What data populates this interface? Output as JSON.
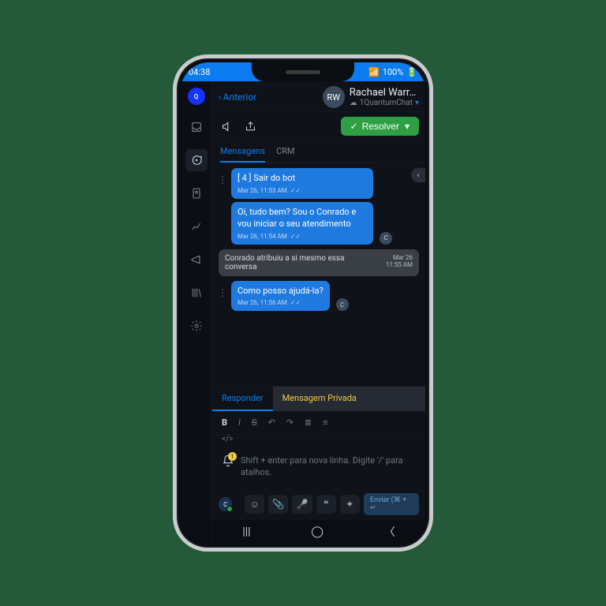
{
  "status": {
    "time": "04:38",
    "battery": "100%"
  },
  "header": {
    "back": "Anterior",
    "initials": "RW",
    "name": "Rachael Warr…",
    "channel": "1QuantumChat"
  },
  "actions": {
    "resolve": "Resolver"
  },
  "convtabs": {
    "messages": "Mensagens",
    "crm": "CRM"
  },
  "msgs": {
    "m1": {
      "text": "[ 4 ] Sair do bot",
      "time": "Mar 26, 11:53 AM"
    },
    "m2": {
      "text": "Oi, tudo bem? Sou o Conrado e vou iniciar o seu atendimento",
      "time": "Mar 26, 11:54 AM"
    },
    "sys": {
      "text": "Conrado atribuiu a si mesmo essa conversa",
      "date": "Mar 26",
      "time": "11:55 AM"
    },
    "m3": {
      "text": "Como posso ajudá-la?",
      "time": "Mar 26, 11:56 AM"
    },
    "owner": "C"
  },
  "reply": {
    "reply": "Responder",
    "private": "Mensagem Privada"
  },
  "toolbar": {
    "bold": "B",
    "italic": "I",
    "strike": "S",
    "undo": "↶",
    "redo": "↷",
    "list": "≣",
    "ol": "≡",
    "code": "</>"
  },
  "composer": {
    "placeholder": "Shift + enter para nova linha. Digite '/' para atalhos.",
    "badge": "1"
  },
  "bottombar": {
    "send": "Enviar (⌘ + ↵"
  }
}
